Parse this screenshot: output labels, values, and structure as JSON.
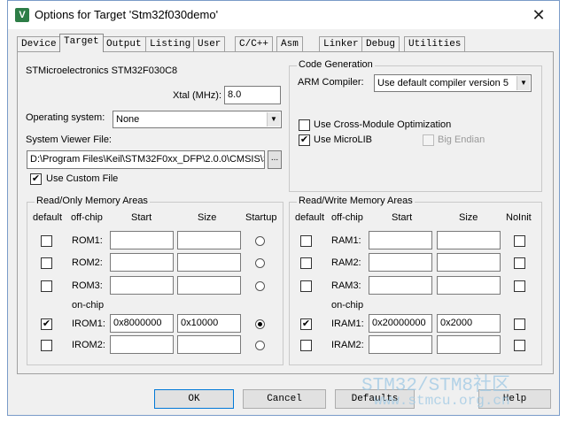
{
  "window": {
    "title": "Options for Target 'Stm32f030demo'",
    "icon_letter": "V",
    "close_glyph": "✕"
  },
  "tabs": [
    {
      "label": "Device"
    },
    {
      "label": "Target",
      "active": true
    },
    {
      "label": "Output"
    },
    {
      "label": "Listing"
    },
    {
      "label": "User"
    },
    {
      "label": "C/C++"
    },
    {
      "label": "Asm"
    },
    {
      "label": "Linker"
    },
    {
      "label": "Debug"
    },
    {
      "label": "Utilities"
    }
  ],
  "target": {
    "device_name": "STMicroelectronics STM32F030C8",
    "xtal_label": "Xtal (MHz):",
    "xtal_value": "8.0",
    "os_label": "Operating system:",
    "os_value": "None",
    "svf_label": "System Viewer File:",
    "svf_value": "D:\\Program Files\\Keil\\STM32F0xx_DFP\\2.0.0\\CMSIS\\S",
    "browse_glyph": "...",
    "use_custom_file_label": "Use Custom File",
    "use_custom_file_checked": "✔"
  },
  "code_generation": {
    "title": "Code Generation",
    "compiler_label": "ARM Compiler:",
    "compiler_value": "Use default compiler version 5",
    "cross_module_label": "Use Cross-Module Optimization",
    "microlib_label": "Use MicroLIB",
    "microlib_checked": "✔",
    "big_endian_label": "Big Endian"
  },
  "ro_memory": {
    "title": "Read/Only Memory Areas",
    "headers": {
      "default": "default",
      "offchip": "off-chip",
      "start": "Start",
      "size": "Size",
      "startup": "Startup"
    },
    "onchip_label": "on-chip",
    "rows": [
      {
        "name": "ROM1:",
        "start": "",
        "size": "",
        "default": "",
        "startup": false
      },
      {
        "name": "ROM2:",
        "start": "",
        "size": "",
        "default": "",
        "startup": false
      },
      {
        "name": "ROM3:",
        "start": "",
        "size": "",
        "default": "",
        "startup": false
      },
      {
        "name": "IROM1:",
        "start": "0x8000000",
        "size": "0x10000",
        "default": "✔",
        "startup": true
      },
      {
        "name": "IROM2:",
        "start": "",
        "size": "",
        "default": "",
        "startup": false
      }
    ]
  },
  "rw_memory": {
    "title": "Read/Write Memory Areas",
    "headers": {
      "default": "default",
      "offchip": "off-chip",
      "start": "Start",
      "size": "Size",
      "noinit": "NoInit"
    },
    "onchip_label": "on-chip",
    "rows": [
      {
        "name": "RAM1:",
        "start": "",
        "size": "",
        "default": ""
      },
      {
        "name": "RAM2:",
        "start": "",
        "size": "",
        "default": ""
      },
      {
        "name": "RAM3:",
        "start": "",
        "size": "",
        "default": ""
      },
      {
        "name": "IRAM1:",
        "start": "0x20000000",
        "size": "0x2000",
        "default": "✔"
      },
      {
        "name": "IRAM2:",
        "start": "",
        "size": "",
        "default": ""
      }
    ]
  },
  "buttons": {
    "ok": "OK",
    "cancel": "Cancel",
    "defaults": "Defaults",
    "help": "Help"
  },
  "watermark": {
    "line1": "STM32/STM8社区",
    "line2": "www.stmcu.org.cn"
  },
  "colors": {
    "accent_border": "#0078d7",
    "watermark": "#9fc9e4"
  }
}
